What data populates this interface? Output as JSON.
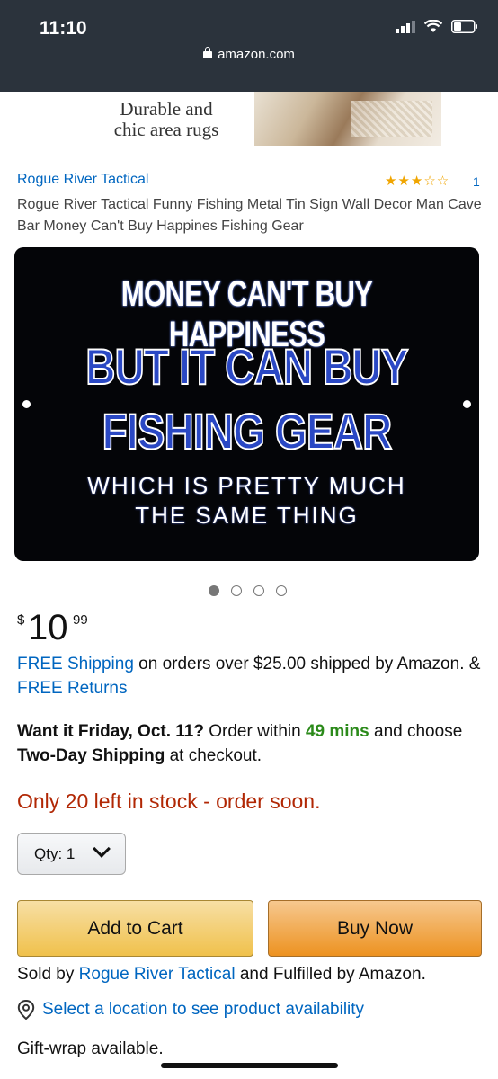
{
  "status_bar": {
    "time": "11:10",
    "url": "amazon.com"
  },
  "ad": {
    "text_line1": "Durable and",
    "text_line2": "chic area rugs"
  },
  "product": {
    "brand": "Rogue River Tactical",
    "rating_stars": "★★★☆☆",
    "review_count": "1",
    "title": "Rogue River Tactical Funny Fishing Metal Tin Sign Wall Decor Man Cave Bar Money Can't Buy Happines Fishing Gear",
    "image_text": {
      "line1": "MONEY CAN'T BUY HAPPINESS",
      "line2": "BUT IT CAN BUY",
      "line3": "FISHING GEAR",
      "line4": "WHICH IS PRETTY MUCH",
      "line5": "THE SAME THING"
    },
    "image_dots_total": 4,
    "image_dot_active": 1
  },
  "price": {
    "currency": "$",
    "whole": "10",
    "fraction": "99"
  },
  "shipping": {
    "free_shipping_link": "FREE Shipping",
    "text": " on orders over $25.00 shipped by Amazon. & ",
    "free_returns_link": "FREE Returns"
  },
  "delivery": {
    "want_it": "Want it Friday, Oct. 11?",
    "order_within": " Order within ",
    "time_left": "49 mins",
    "and_choose": " and choose ",
    "shipping_option": "Two-Day Shipping",
    "at_checkout": " at checkout."
  },
  "stock": "Only 20 left in stock - order soon.",
  "quantity": {
    "label": "Qty:",
    "value": "1"
  },
  "buttons": {
    "add_to_cart": "Add to Cart",
    "buy_now": "Buy Now"
  },
  "seller": {
    "sold_by": "Sold by ",
    "seller_link": "Rogue River Tactical",
    "fulfilled": " and Fulfilled by Amazon."
  },
  "location_link": "Select a location to see product availability",
  "gift_wrap": "Gift-wrap available.",
  "colors": {
    "link": "#0066c0",
    "price_alert": "#b12704",
    "green": "#2b8a1a",
    "add_to_cart": "#f0c14b",
    "buy_now": "#ed9220"
  }
}
